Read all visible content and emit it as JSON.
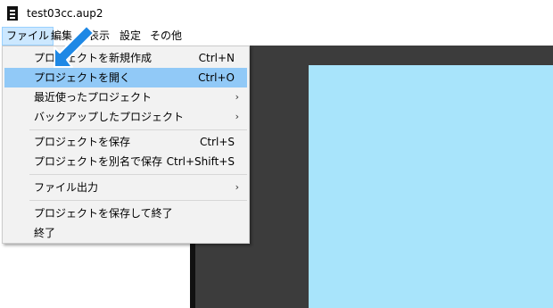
{
  "window": {
    "title": "test03cc.aup2"
  },
  "menubar": {
    "items": [
      {
        "label": "ファイル",
        "active": true
      },
      {
        "label": "編集",
        "active": false
      },
      {
        "label": "表示",
        "active": false
      },
      {
        "label": "設定",
        "active": false
      },
      {
        "label": "その他",
        "active": false
      }
    ]
  },
  "file_menu": {
    "items": [
      {
        "label": "プロジェクトを新規作成",
        "shortcut": "Ctrl+N",
        "submenu": false
      },
      {
        "label": "プロジェクトを開く",
        "shortcut": "Ctrl+O",
        "submenu": false,
        "highlighted": true
      },
      {
        "label": "最近使ったプロジェクト",
        "shortcut": "",
        "submenu": true
      },
      {
        "label": "バックアップしたプロジェクト",
        "shortcut": "",
        "submenu": true
      },
      {
        "label": "プロジェクトを保存",
        "shortcut": "Ctrl+S",
        "submenu": false
      },
      {
        "label": "プロジェクトを別名で保存",
        "shortcut": "Ctrl+Shift+S",
        "submenu": false
      },
      {
        "label": "ファイル出力",
        "shortcut": "",
        "submenu": true
      },
      {
        "label": "プロジェクトを保存して終了",
        "shortcut": "",
        "submenu": false
      },
      {
        "label": "終了",
        "shortcut": "",
        "submenu": false
      }
    ],
    "submenu_glyph": "›"
  },
  "colors": {
    "highlight": "#91c9f7",
    "canvas_bg": "#3c3c3c",
    "canvas_frame": "#a8e4fb",
    "pointer_arrow": "#1e88e5"
  },
  "icons": {
    "app": "film-strip-icon",
    "pointer": "blue-pointer-arrow-icon"
  }
}
